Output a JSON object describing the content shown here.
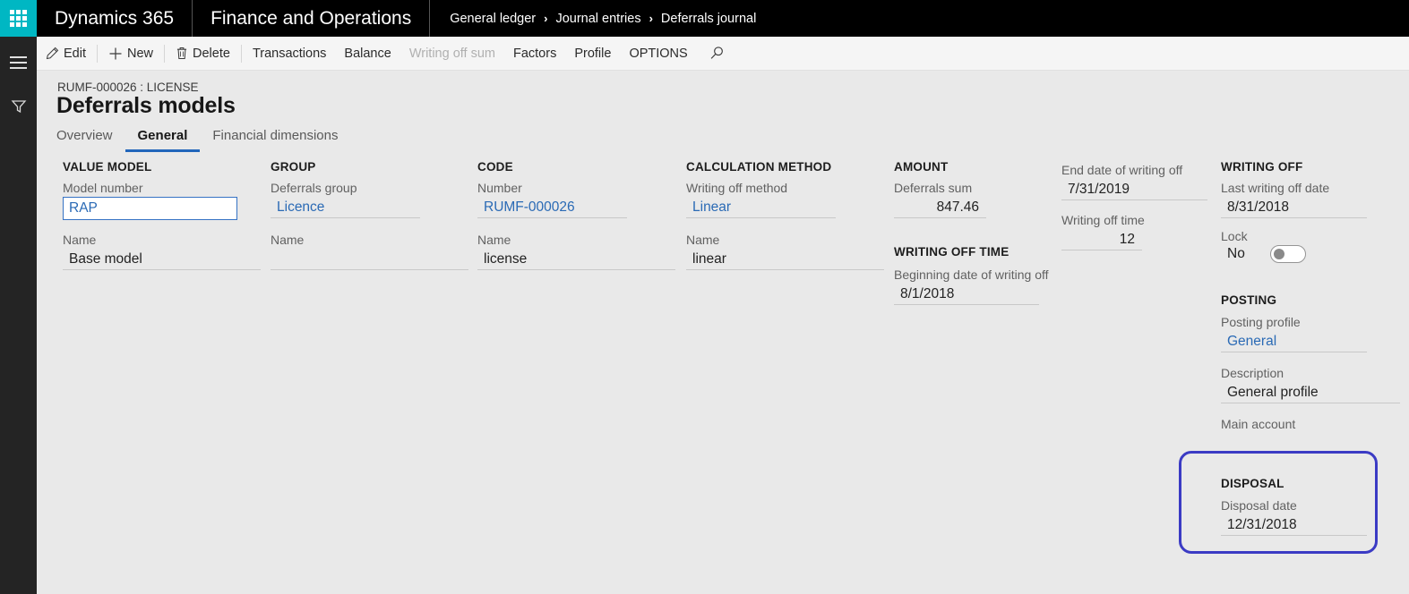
{
  "rail": {
    "waffle_icon": "waffle-grid-icon",
    "menu_icon": "hamburger-icon",
    "filter_icon": "filter-funnel-icon"
  },
  "topbar": {
    "brand": "Dynamics 365",
    "module": "Finance and Operations",
    "breadcrumb": [
      "General ledger",
      "Journal entries",
      "Deferrals journal"
    ],
    "separator": "›"
  },
  "commandbar": {
    "items": [
      {
        "label": "Edit",
        "icon": "pencil-icon",
        "disabled": false
      },
      {
        "label": "New",
        "icon": "plus-icon",
        "disabled": false
      },
      {
        "label": "Delete",
        "icon": "trash-icon",
        "disabled": false
      },
      {
        "label": "Transactions",
        "icon": "",
        "disabled": false
      },
      {
        "label": "Balance",
        "icon": "",
        "disabled": false
      },
      {
        "label": "Writing off sum",
        "icon": "",
        "disabled": true
      },
      {
        "label": "Factors",
        "icon": "",
        "disabled": false
      },
      {
        "label": "Profile",
        "icon": "",
        "disabled": false
      },
      {
        "label": "OPTIONS",
        "icon": "",
        "disabled": false
      }
    ],
    "search_icon": "search-icon"
  },
  "page": {
    "record_caption": "RUMF-000026 : LICENSE",
    "title": "Deferrals models",
    "tabs": [
      {
        "label": "Overview",
        "active": false
      },
      {
        "label": "General",
        "active": true
      },
      {
        "label": "Financial dimensions",
        "active": false
      }
    ]
  },
  "sections": {
    "value_model": {
      "heading": "VALUE MODEL",
      "model_number": {
        "label": "Model number",
        "value": "RAP"
      },
      "name": {
        "label": "Name",
        "value": "Base model"
      }
    },
    "group": {
      "heading": "GROUP",
      "deferrals_group": {
        "label": "Deferrals group",
        "value": "Licence"
      },
      "name": {
        "label": "Name",
        "value": ""
      }
    },
    "code": {
      "heading": "CODE",
      "number": {
        "label": "Number",
        "value": "RUMF-000026"
      },
      "name": {
        "label": "Name",
        "value": "license"
      }
    },
    "calculation_method": {
      "heading": "CALCULATION METHOD",
      "writing_off_method": {
        "label": "Writing off method",
        "value": "Linear"
      },
      "name": {
        "label": "Name",
        "value": "linear"
      }
    },
    "amount": {
      "heading": "AMOUNT",
      "deferrals_sum": {
        "label": "Deferrals sum",
        "value": "847.46"
      }
    },
    "writing_off_time": {
      "heading": "WRITING OFF TIME",
      "beginning_date": {
        "label": "Beginning date of writing off",
        "value": "8/1/2018"
      },
      "end_date": {
        "label": "End date of writing off",
        "value": "7/31/2019"
      },
      "time": {
        "label": "Writing off time",
        "value": "12"
      }
    },
    "writing_off": {
      "heading": "WRITING OFF",
      "last_date": {
        "label": "Last writing off date",
        "value": "8/31/2018"
      },
      "lock": {
        "label": "Lock",
        "value": "No"
      }
    },
    "posting": {
      "heading": "POSTING",
      "posting_profile": {
        "label": "Posting profile",
        "value": "General"
      },
      "description": {
        "label": "Description",
        "value": "General profile"
      },
      "main_account": {
        "label": "Main account",
        "value": ""
      }
    },
    "disposal": {
      "heading": "DISPOSAL",
      "disposal_date": {
        "label": "Disposal date",
        "value": "12/31/2018"
      }
    }
  },
  "colors": {
    "rail_bg": "#242424",
    "waffle_accent": "#00b7c3",
    "topbar_bg": "#000000",
    "content_bg": "#e9e9e9",
    "link": "#2a6ab5",
    "tab_active_underline": "#2266bb",
    "highlight_border": "#3b3bc4"
  }
}
